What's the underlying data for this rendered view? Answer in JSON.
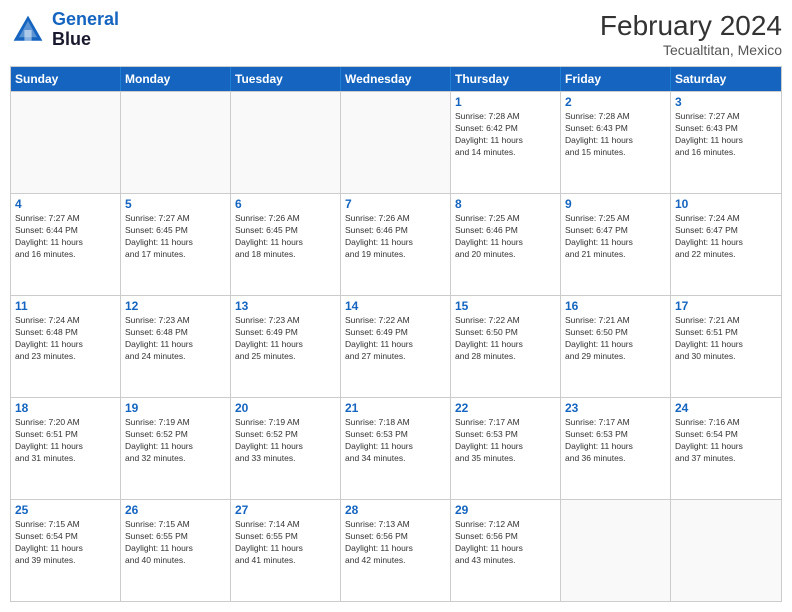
{
  "header": {
    "logo_line1": "General",
    "logo_line2": "Blue",
    "month_title": "February 2024",
    "location": "Tecualtitan, Mexico"
  },
  "days_of_week": [
    "Sunday",
    "Monday",
    "Tuesday",
    "Wednesday",
    "Thursday",
    "Friday",
    "Saturday"
  ],
  "weeks": [
    [
      {
        "day": "",
        "info": ""
      },
      {
        "day": "",
        "info": ""
      },
      {
        "day": "",
        "info": ""
      },
      {
        "day": "",
        "info": ""
      },
      {
        "day": "1",
        "info": "Sunrise: 7:28 AM\nSunset: 6:42 PM\nDaylight: 11 hours\nand 14 minutes."
      },
      {
        "day": "2",
        "info": "Sunrise: 7:28 AM\nSunset: 6:43 PM\nDaylight: 11 hours\nand 15 minutes."
      },
      {
        "day": "3",
        "info": "Sunrise: 7:27 AM\nSunset: 6:43 PM\nDaylight: 11 hours\nand 16 minutes."
      }
    ],
    [
      {
        "day": "4",
        "info": "Sunrise: 7:27 AM\nSunset: 6:44 PM\nDaylight: 11 hours\nand 16 minutes."
      },
      {
        "day": "5",
        "info": "Sunrise: 7:27 AM\nSunset: 6:45 PM\nDaylight: 11 hours\nand 17 minutes."
      },
      {
        "day": "6",
        "info": "Sunrise: 7:26 AM\nSunset: 6:45 PM\nDaylight: 11 hours\nand 18 minutes."
      },
      {
        "day": "7",
        "info": "Sunrise: 7:26 AM\nSunset: 6:46 PM\nDaylight: 11 hours\nand 19 minutes."
      },
      {
        "day": "8",
        "info": "Sunrise: 7:25 AM\nSunset: 6:46 PM\nDaylight: 11 hours\nand 20 minutes."
      },
      {
        "day": "9",
        "info": "Sunrise: 7:25 AM\nSunset: 6:47 PM\nDaylight: 11 hours\nand 21 minutes."
      },
      {
        "day": "10",
        "info": "Sunrise: 7:24 AM\nSunset: 6:47 PM\nDaylight: 11 hours\nand 22 minutes."
      }
    ],
    [
      {
        "day": "11",
        "info": "Sunrise: 7:24 AM\nSunset: 6:48 PM\nDaylight: 11 hours\nand 23 minutes."
      },
      {
        "day": "12",
        "info": "Sunrise: 7:23 AM\nSunset: 6:48 PM\nDaylight: 11 hours\nand 24 minutes."
      },
      {
        "day": "13",
        "info": "Sunrise: 7:23 AM\nSunset: 6:49 PM\nDaylight: 11 hours\nand 25 minutes."
      },
      {
        "day": "14",
        "info": "Sunrise: 7:22 AM\nSunset: 6:49 PM\nDaylight: 11 hours\nand 27 minutes."
      },
      {
        "day": "15",
        "info": "Sunrise: 7:22 AM\nSunset: 6:50 PM\nDaylight: 11 hours\nand 28 minutes."
      },
      {
        "day": "16",
        "info": "Sunrise: 7:21 AM\nSunset: 6:50 PM\nDaylight: 11 hours\nand 29 minutes."
      },
      {
        "day": "17",
        "info": "Sunrise: 7:21 AM\nSunset: 6:51 PM\nDaylight: 11 hours\nand 30 minutes."
      }
    ],
    [
      {
        "day": "18",
        "info": "Sunrise: 7:20 AM\nSunset: 6:51 PM\nDaylight: 11 hours\nand 31 minutes."
      },
      {
        "day": "19",
        "info": "Sunrise: 7:19 AM\nSunset: 6:52 PM\nDaylight: 11 hours\nand 32 minutes."
      },
      {
        "day": "20",
        "info": "Sunrise: 7:19 AM\nSunset: 6:52 PM\nDaylight: 11 hours\nand 33 minutes."
      },
      {
        "day": "21",
        "info": "Sunrise: 7:18 AM\nSunset: 6:53 PM\nDaylight: 11 hours\nand 34 minutes."
      },
      {
        "day": "22",
        "info": "Sunrise: 7:17 AM\nSunset: 6:53 PM\nDaylight: 11 hours\nand 35 minutes."
      },
      {
        "day": "23",
        "info": "Sunrise: 7:17 AM\nSunset: 6:53 PM\nDaylight: 11 hours\nand 36 minutes."
      },
      {
        "day": "24",
        "info": "Sunrise: 7:16 AM\nSunset: 6:54 PM\nDaylight: 11 hours\nand 37 minutes."
      }
    ],
    [
      {
        "day": "25",
        "info": "Sunrise: 7:15 AM\nSunset: 6:54 PM\nDaylight: 11 hours\nand 39 minutes."
      },
      {
        "day": "26",
        "info": "Sunrise: 7:15 AM\nSunset: 6:55 PM\nDaylight: 11 hours\nand 40 minutes."
      },
      {
        "day": "27",
        "info": "Sunrise: 7:14 AM\nSunset: 6:55 PM\nDaylight: 11 hours\nand 41 minutes."
      },
      {
        "day": "28",
        "info": "Sunrise: 7:13 AM\nSunset: 6:56 PM\nDaylight: 11 hours\nand 42 minutes."
      },
      {
        "day": "29",
        "info": "Sunrise: 7:12 AM\nSunset: 6:56 PM\nDaylight: 11 hours\nand 43 minutes."
      },
      {
        "day": "",
        "info": ""
      },
      {
        "day": "",
        "info": ""
      }
    ]
  ]
}
